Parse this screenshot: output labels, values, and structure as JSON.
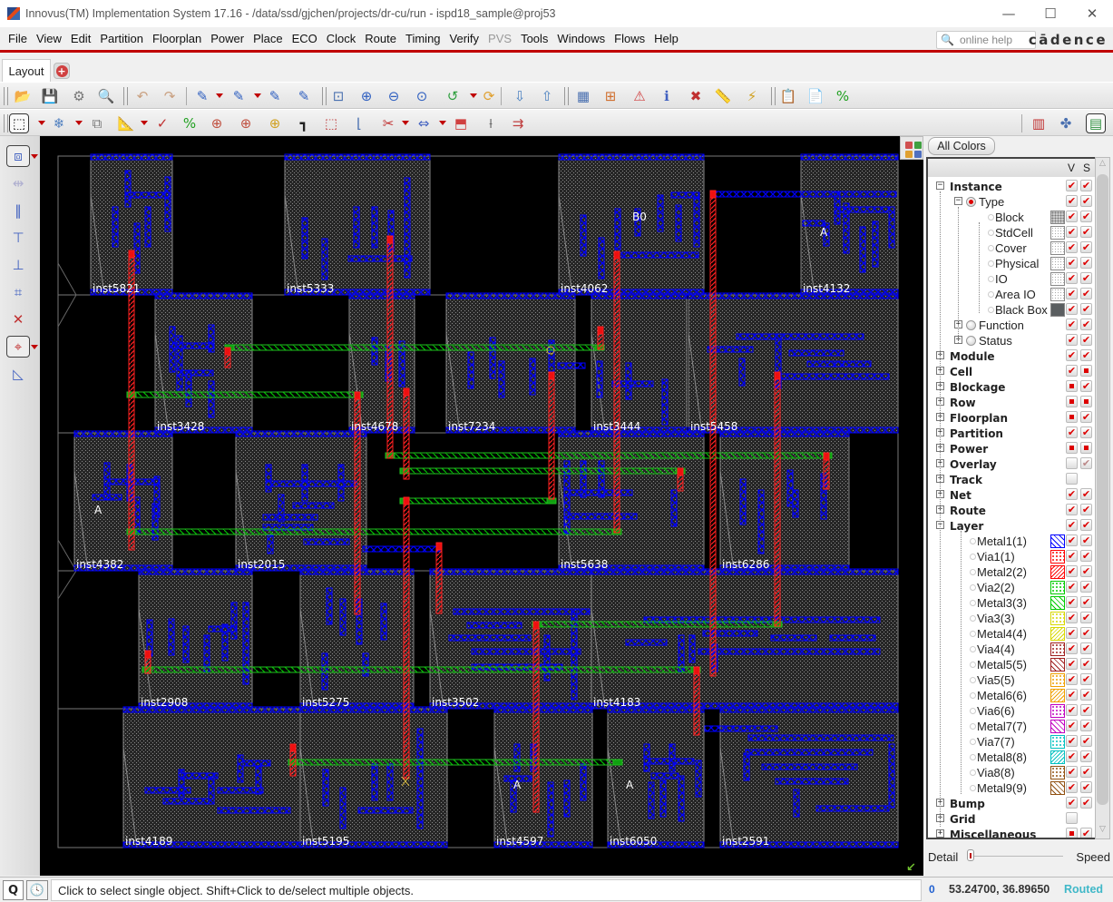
{
  "window": {
    "title": "Innovus(TM) Implementation System 17.16 - /data/ssd/gjchen/projects/dr-cu/run - ispd18_sample@proj53",
    "controls": [
      "minimize",
      "maximize",
      "close"
    ]
  },
  "menu": {
    "items": [
      {
        "label": "File",
        "enabled": true
      },
      {
        "label": "View",
        "enabled": true
      },
      {
        "label": "Edit",
        "enabled": true
      },
      {
        "label": "Partition",
        "enabled": true
      },
      {
        "label": "Floorplan",
        "enabled": true
      },
      {
        "label": "Power",
        "enabled": true
      },
      {
        "label": "Place",
        "enabled": true
      },
      {
        "label": "ECO",
        "enabled": true
      },
      {
        "label": "Clock",
        "enabled": true
      },
      {
        "label": "Route",
        "enabled": true
      },
      {
        "label": "Timing",
        "enabled": true
      },
      {
        "label": "Verify",
        "enabled": true
      },
      {
        "label": "PVS",
        "enabled": false
      },
      {
        "label": "Tools",
        "enabled": true
      },
      {
        "label": "Windows",
        "enabled": true
      },
      {
        "label": "Flows",
        "enabled": true
      },
      {
        "label": "Help",
        "enabled": true
      }
    ],
    "help_placeholder": "online help",
    "brand": "cādence"
  },
  "tabs": {
    "active": "Layout",
    "add_icon": "plus-icon"
  },
  "toolbar1": [
    {
      "icon": "open-folder-icon",
      "glyph": "📂"
    },
    {
      "icon": "save-icon",
      "glyph": "💾"
    },
    {
      "icon": "settings-gear-icon",
      "glyph": "⚙"
    },
    {
      "icon": "design-browser-icon",
      "glyph": "🔍"
    },
    {
      "icon": "undo-icon",
      "glyph": "↶"
    },
    {
      "icon": "redo-icon",
      "glyph": "↷"
    },
    {
      "icon": "select-edit-icon",
      "glyph": "✎"
    },
    {
      "icon": "delete-edit-icon",
      "glyph": "✎"
    },
    {
      "icon": "delete-all-edit-icon",
      "glyph": "✎"
    },
    {
      "icon": "select-delete-icon",
      "glyph": "✎"
    },
    {
      "icon": "zoom-fit-icon",
      "glyph": "⊡"
    },
    {
      "icon": "zoom-in-icon",
      "glyph": "⊕"
    },
    {
      "icon": "zoom-out-icon",
      "glyph": "⊖"
    },
    {
      "icon": "zoom-selected-icon",
      "glyph": "⊙"
    },
    {
      "icon": "zoom-previous-icon",
      "glyph": "↺"
    },
    {
      "icon": "redraw-icon",
      "glyph": "⟳"
    },
    {
      "icon": "hierarchy-down-icon",
      "glyph": "⇩"
    },
    {
      "icon": "hierarchy-up-icon",
      "glyph": "⇧"
    },
    {
      "icon": "layout-view-icon",
      "glyph": "▦"
    },
    {
      "icon": "hierarchy-tree-icon",
      "glyph": "⊞"
    },
    {
      "icon": "violation-warning-icon",
      "glyph": "⚠"
    },
    {
      "icon": "info-icon",
      "glyph": "ℹ"
    },
    {
      "icon": "clear-markers-icon",
      "glyph": "✖"
    },
    {
      "icon": "ruler-clear-icon",
      "glyph": "📏"
    },
    {
      "icon": "warning-edit-icon",
      "glyph": "⚡"
    },
    {
      "icon": "notes-icon",
      "glyph": "📋"
    },
    {
      "icon": "log-icon",
      "glyph": "📄"
    },
    {
      "icon": "percent-icon",
      "glyph": "%"
    }
  ],
  "toolbar2": [
    {
      "icon": "select-mode-icon",
      "glyph": "⬚",
      "selected": true
    },
    {
      "icon": "snowflake-icon",
      "glyph": "❄"
    },
    {
      "icon": "copy-icon",
      "glyph": "⧉"
    },
    {
      "icon": "ruler-icon",
      "glyph": "📐"
    },
    {
      "icon": "check-chart-icon",
      "glyph": "✓"
    },
    {
      "icon": "percent-green-icon",
      "glyph": "%"
    },
    {
      "icon": "add-instance-icon",
      "glyph": "⊕"
    },
    {
      "icon": "add-instance-2-icon",
      "glyph": "⊕"
    },
    {
      "icon": "add-instance-3-icon",
      "glyph": "⊕"
    },
    {
      "icon": "wire-icon",
      "glyph": "┓"
    },
    {
      "icon": "select-box-icon",
      "glyph": "⬚"
    },
    {
      "icon": "stretch-icon",
      "glyph": "⌊"
    },
    {
      "icon": "cut-icon",
      "glyph": "✂"
    },
    {
      "icon": "spacing-icon",
      "glyph": "⇔"
    },
    {
      "icon": "move-icon",
      "glyph": "⬒"
    },
    {
      "icon": "reshape-icon",
      "glyph": "⟊"
    },
    {
      "icon": "move-group-icon",
      "glyph": "⇉"
    },
    {
      "icon": "floorplan-view-icon",
      "glyph": "▥"
    },
    {
      "icon": "amoeba-view-icon",
      "glyph": "✤"
    },
    {
      "icon": "physical-view-icon",
      "glyph": "▤",
      "selected": true
    }
  ],
  "lefttoolbar": [
    {
      "icon": "layer-stack-icon",
      "glyph": "⧈",
      "selected": true
    },
    {
      "icon": "align-center-icon",
      "glyph": "⇹"
    },
    {
      "icon": "vertical-spacing-icon",
      "glyph": "‖"
    },
    {
      "icon": "align-top-icon",
      "glyph": "⊤"
    },
    {
      "icon": "align-bottom-icon",
      "glyph": "⊥"
    },
    {
      "icon": "distribute-icon",
      "glyph": "⌗"
    },
    {
      "icon": "delete-align-icon",
      "glyph": "✕"
    },
    {
      "icon": "snap-grid-icon",
      "glyph": "⌖",
      "selected": true
    },
    {
      "icon": "flip-icon",
      "glyph": "◺"
    }
  ],
  "canvas": {
    "instances": [
      "inst5821",
      "inst5333",
      "inst4062",
      "inst4132",
      "inst3428",
      "inst4678",
      "inst7234",
      "inst3444",
      "inst5458",
      "inst4382",
      "inst2015",
      "inst5638",
      "inst6286",
      "inst2908",
      "inst5275",
      "inst3502",
      "inst4183",
      "inst4189",
      "inst5195",
      "inst4597",
      "inst6050",
      "inst2591"
    ],
    "pin_labels": [
      "B0",
      "A",
      "A",
      "A",
      "A"
    ],
    "colors": {
      "background": "#000000",
      "metal1": "#0000ff",
      "metal2": "#ff0000",
      "metal3": "#00cc00",
      "instance_fill": "#3a3a3a",
      "label": "#ffffff"
    }
  },
  "layerpanel": {
    "all_colors_label": "All Colors",
    "col_v": "V",
    "col_s": "S",
    "rows": [
      {
        "label": "Instance",
        "level": 0,
        "bold": true,
        "expand": "-",
        "v": "on",
        "s": "on"
      },
      {
        "label": "Type",
        "level": 1,
        "radio": "on",
        "expand": "-",
        "v": "on",
        "s": "on"
      },
      {
        "label": "Block",
        "level": 2,
        "radio": "small",
        "swatch": "#a8a8a8",
        "v": "on",
        "s": "on"
      },
      {
        "label": "StdCell",
        "level": 2,
        "radio": "small",
        "swatch": "#eeeeee",
        "v": "on",
        "s": "on"
      },
      {
        "label": "Cover",
        "level": 2,
        "radio": "small",
        "swatch": "#eeeeee",
        "v": "on",
        "s": "on"
      },
      {
        "label": "Physical",
        "level": 2,
        "radio": "small",
        "swatch": "#eeeeee",
        "v": "on",
        "s": "on"
      },
      {
        "label": "IO",
        "level": 2,
        "radio": "small",
        "swatch": "#eeeeee",
        "v": "on",
        "s": "on"
      },
      {
        "label": "Area IO",
        "level": 2,
        "radio": "small",
        "swatch": "#eeeeee",
        "v": "on",
        "s": "on"
      },
      {
        "label": "Black Box",
        "level": 2,
        "radio": "small",
        "swatch": "#5a5e60",
        "v": "on",
        "s": "on"
      },
      {
        "label": "Function",
        "level": 1,
        "radio": "off",
        "expand": "+",
        "v": "on",
        "s": "on"
      },
      {
        "label": "Status",
        "level": 1,
        "radio": "off",
        "expand": "+",
        "v": "on",
        "s": "on"
      },
      {
        "label": "Module",
        "level": 0,
        "bold": true,
        "expand": "+",
        "v": "on",
        "s": "on"
      },
      {
        "label": "Cell",
        "level": 0,
        "bold": true,
        "expand": "+",
        "v": "on",
        "s": "partial"
      },
      {
        "label": "Blockage",
        "level": 0,
        "bold": true,
        "expand": "+",
        "v": "partial",
        "s": "on"
      },
      {
        "label": "Row",
        "level": 0,
        "bold": true,
        "expand": "+",
        "v": "partial",
        "s": "partial"
      },
      {
        "label": "Floorplan",
        "level": 0,
        "bold": true,
        "expand": "+",
        "v": "partial",
        "s": "on"
      },
      {
        "label": "Partition",
        "level": 0,
        "bold": true,
        "expand": "+",
        "v": "on",
        "s": "on"
      },
      {
        "label": "Power",
        "level": 0,
        "bold": true,
        "expand": "+",
        "v": "partial",
        "s": "partial"
      },
      {
        "label": "Overlay",
        "level": 0,
        "bold": true,
        "expand": "+",
        "v": "off",
        "s": "dim"
      },
      {
        "label": "Track",
        "level": 0,
        "bold": true,
        "expand": "+",
        "v": "off",
        "s": "none"
      },
      {
        "label": "Net",
        "level": 0,
        "bold": true,
        "expand": "+",
        "v": "on",
        "s": "on"
      },
      {
        "label": "Route",
        "level": 0,
        "bold": true,
        "expand": "+",
        "v": "on",
        "s": "on"
      },
      {
        "label": "Layer",
        "level": 0,
        "bold": true,
        "expand": "-",
        "v": "on",
        "s": "on"
      },
      {
        "label": "Metal1(1)",
        "level": 2,
        "radio": "small",
        "swatch": "#0000ff",
        "pattern": "hatch-back",
        "v": "on",
        "s": "on"
      },
      {
        "label": "Via1(1)",
        "level": 2,
        "radio": "small",
        "swatch": "#ff0000",
        "pattern": "dots",
        "v": "on",
        "s": "on"
      },
      {
        "label": "Metal2(2)",
        "level": 2,
        "radio": "small",
        "swatch": "#ff0000",
        "pattern": "hatch",
        "v": "on",
        "s": "on"
      },
      {
        "label": "Via2(2)",
        "level": 2,
        "radio": "small",
        "swatch": "#00cc00",
        "pattern": "dots",
        "v": "on",
        "s": "on"
      },
      {
        "label": "Metal3(3)",
        "level": 2,
        "radio": "small",
        "swatch": "#00cc00",
        "pattern": "hatch-back",
        "v": "on",
        "s": "on"
      },
      {
        "label": "Via3(3)",
        "level": 2,
        "radio": "small",
        "swatch": "#d8d800",
        "pattern": "dots",
        "v": "on",
        "s": "on"
      },
      {
        "label": "Metal4(4)",
        "level": 2,
        "radio": "small",
        "swatch": "#d8d800",
        "pattern": "hatch",
        "v": "on",
        "s": "on"
      },
      {
        "label": "Via4(4)",
        "level": 2,
        "radio": "small",
        "swatch": "#a02020",
        "pattern": "dots",
        "v": "on",
        "s": "on"
      },
      {
        "label": "Metal5(5)",
        "level": 2,
        "radio": "small",
        "swatch": "#a02020",
        "pattern": "hatch-back",
        "v": "on",
        "s": "on"
      },
      {
        "label": "Via5(5)",
        "level": 2,
        "radio": "small",
        "swatch": "#f0a000",
        "pattern": "dots",
        "v": "on",
        "s": "on"
      },
      {
        "label": "Metal6(6)",
        "level": 2,
        "radio": "small",
        "swatch": "#f0a000",
        "pattern": "hatch",
        "v": "on",
        "s": "on"
      },
      {
        "label": "Via6(6)",
        "level": 2,
        "radio": "small",
        "swatch": "#c000c0",
        "pattern": "dots",
        "v": "on",
        "s": "on"
      },
      {
        "label": "Metal7(7)",
        "level": 2,
        "radio": "small",
        "swatch": "#c000c0",
        "pattern": "hatch-back",
        "v": "on",
        "s": "on"
      },
      {
        "label": "Via7(7)",
        "level": 2,
        "radio": "small",
        "swatch": "#00c0c0",
        "pattern": "dots",
        "v": "on",
        "s": "on"
      },
      {
        "label": "Metal8(8)",
        "level": 2,
        "radio": "small",
        "swatch": "#00c0c0",
        "pattern": "hatch",
        "v": "on",
        "s": "on"
      },
      {
        "label": "Via8(8)",
        "level": 2,
        "radio": "small",
        "swatch": "#905010",
        "pattern": "dots",
        "v": "on",
        "s": "on"
      },
      {
        "label": "Metal9(9)",
        "level": 2,
        "radio": "small",
        "swatch": "#905010",
        "pattern": "hatch-back",
        "v": "on",
        "s": "on"
      },
      {
        "label": "Bump",
        "level": 0,
        "bold": true,
        "expand": "+",
        "v": "on",
        "s": "on"
      },
      {
        "label": "Grid",
        "level": 0,
        "bold": true,
        "expand": "+",
        "v": "off",
        "s": "none"
      },
      {
        "label": "Miscellaneous",
        "level": 0,
        "bold": true,
        "expand": "+",
        "v": "partial",
        "s": "on"
      }
    ],
    "detail_label": "Detail",
    "speed_label": "Speed",
    "detail_level": 0
  },
  "status": {
    "q_label": "Q",
    "message": "Click to select single object. Shift+Click to de/select multiple objects.",
    "selected_count": "0",
    "coordinates": "53.24700, 36.89650",
    "state": "Routed"
  }
}
